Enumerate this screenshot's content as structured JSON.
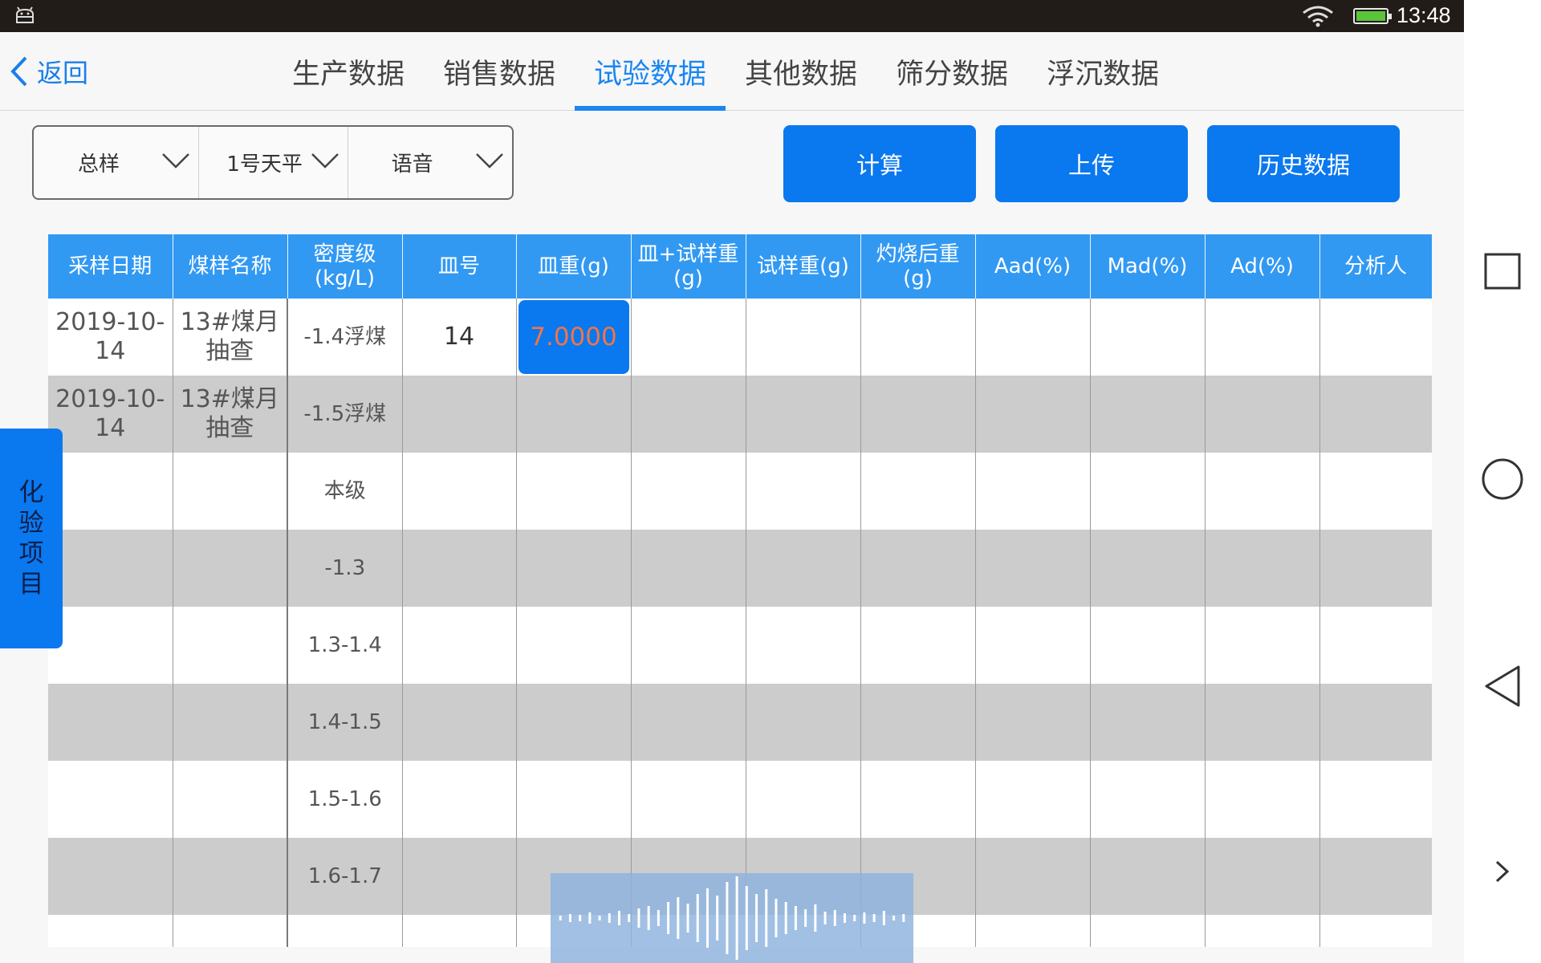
{
  "status_bar": {
    "time": "13:48",
    "icons": [
      "android-icon",
      "wifi-icon",
      "battery-icon"
    ]
  },
  "header": {
    "back_label": "返回",
    "tabs": [
      {
        "label": "生产数据",
        "active": false
      },
      {
        "label": "销售数据",
        "active": false
      },
      {
        "label": "试验数据",
        "active": true
      },
      {
        "label": "其他数据",
        "active": false
      },
      {
        "label": "筛分数据",
        "active": false
      },
      {
        "label": "浮沉数据",
        "active": false
      }
    ]
  },
  "selectors": [
    {
      "value": "总样"
    },
    {
      "value": "1号天平"
    },
    {
      "value": "语音"
    }
  ],
  "actions": {
    "calculate": "计算",
    "upload": "上传",
    "history": "历史数据"
  },
  "side_tab": {
    "chars": [
      "化",
      "验",
      "项",
      "目"
    ]
  },
  "table": {
    "headers": [
      "采样日期",
      "煤样名称",
      "密度级(kg/L)",
      "皿号",
      "皿重(g)",
      "皿+试样重(g)",
      "试样重(g)",
      "灼烧后重(g)",
      "Aad(%)",
      "Mad(%)",
      "Ad(%)",
      "分析人"
    ],
    "rows": [
      {
        "date": "2019-10-14",
        "name": "13#煤月抽查",
        "density": "-1.4浮煤",
        "dish": "14",
        "dish_weight": "7.0000"
      },
      {
        "date": "2019-10-14",
        "name": "13#煤月抽查",
        "density": "-1.5浮煤",
        "dish": "",
        "dish_weight": ""
      },
      {
        "date": "",
        "name": "",
        "density": "本级",
        "dish": "",
        "dish_weight": ""
      },
      {
        "date": "",
        "name": "",
        "density": "-1.3",
        "dish": "",
        "dish_weight": ""
      },
      {
        "date": "",
        "name": "",
        "density": "1.3-1.4",
        "dish": "",
        "dish_weight": ""
      },
      {
        "date": "",
        "name": "",
        "density": "1.4-1.5",
        "dish": "",
        "dish_weight": ""
      },
      {
        "date": "",
        "name": "",
        "density": "1.5-1.6",
        "dish": "",
        "dish_weight": ""
      },
      {
        "date": "",
        "name": "",
        "density": "1.6-1.7",
        "dish": "",
        "dish_weight": ""
      },
      {
        "date": "",
        "name": "",
        "density": "",
        "dish": "",
        "dish_weight": ""
      }
    ]
  },
  "colors": {
    "accent": "#0a78ef",
    "header_bg": "#3299f3",
    "row_alt": "#cccccc",
    "active_value": "#f27447"
  }
}
